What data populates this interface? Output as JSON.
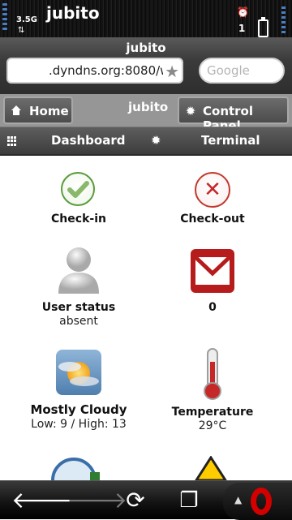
{
  "status_bar": {
    "network": "3.5G",
    "app_title": "jubito",
    "notification_count": "1"
  },
  "browser": {
    "page_title": "jubito",
    "url": ".dyndns.org:8080/w",
    "search_placeholder": "Google"
  },
  "nav": {
    "home_label": "Home",
    "center_title": "jubito",
    "control_panel_label": "Control Panel",
    "dashboard_label": "Dashboard",
    "terminal_label": "Terminal"
  },
  "dashboard": {
    "checkin_label": "Check-in",
    "checkout_label": "Check-out",
    "user_status_label": "User status",
    "user_status_value": "absent",
    "mail_count": "0",
    "weather_label": "Mostly Cloudy",
    "weather_range": "Low: 9 /  High: 13",
    "temperature_label": "Temperature",
    "temperature_value": "29°C"
  },
  "icons": {
    "home": "home-icon",
    "control_panel": "gear-icon",
    "dashboard": "grid-icon",
    "terminal": "gear-icon",
    "back": "back-arrow-icon",
    "forward": "forward-arrow-icon",
    "reload": "reload-icon",
    "windows": "windows-icon",
    "opera": "opera-icon"
  },
  "colors": {
    "check_green": "#5a9c3a",
    "checkout_red": "#c62828",
    "mail_red": "#b71c1c",
    "opera_red": "#d40000"
  }
}
